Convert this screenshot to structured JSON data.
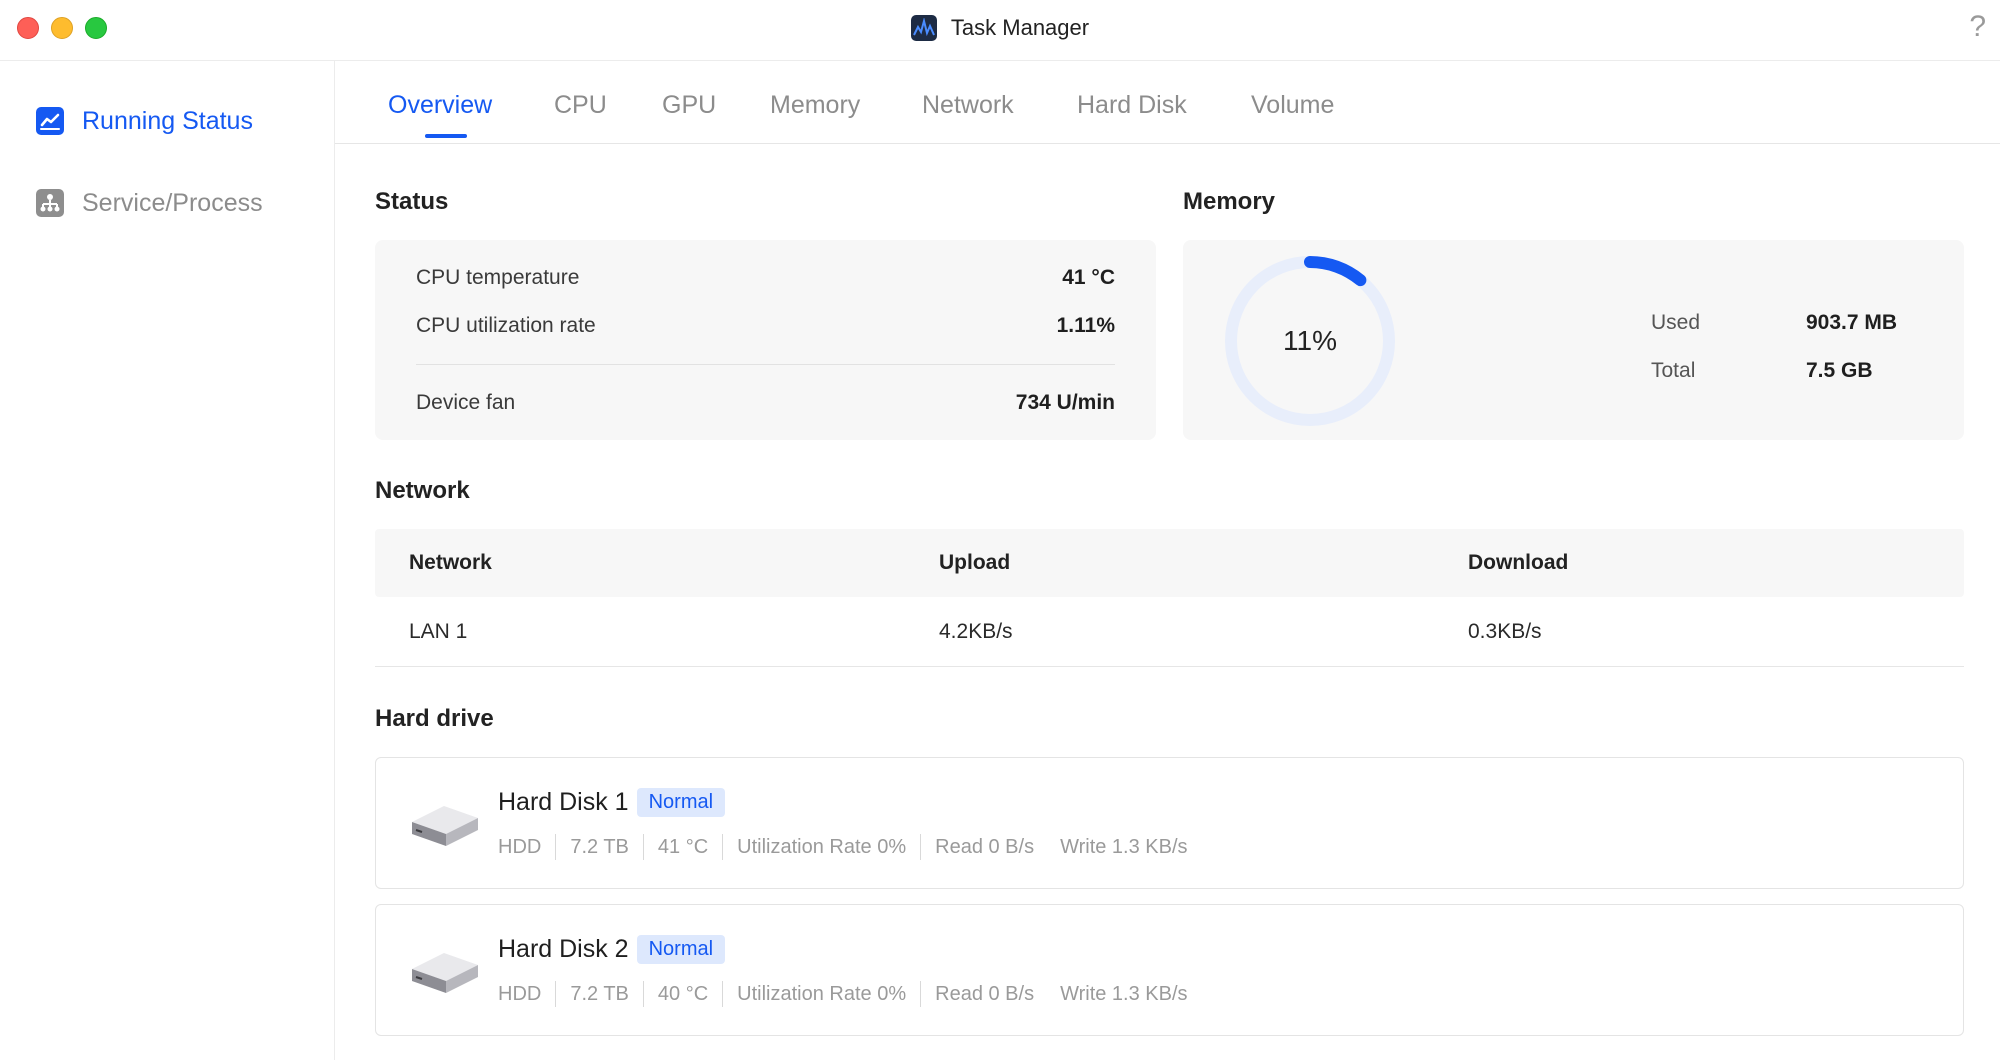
{
  "window": {
    "title": "Task Manager",
    "help": "?"
  },
  "sidebar": {
    "items": [
      {
        "label": "Running Status",
        "icon": "chart-line-icon",
        "active": true
      },
      {
        "label": "Service/Process",
        "icon": "hierarchy-icon",
        "active": false
      }
    ]
  },
  "tabs": [
    "Overview",
    "CPU",
    "GPU",
    "Memory",
    "Network",
    "Hard Disk",
    "Volume"
  ],
  "active_tab": "Overview",
  "status": {
    "title": "Status",
    "rows": [
      {
        "label": "CPU temperature",
        "value": "41 °C"
      },
      {
        "label": "CPU utilization rate",
        "value": "1.11%"
      },
      {
        "label": "Device fan",
        "value": "734 U/min"
      }
    ]
  },
  "memory": {
    "title": "Memory",
    "percent_label": "11%",
    "percent": 11,
    "used_label": "Used",
    "used_value": "903.7 MB",
    "total_label": "Total",
    "total_value": "7.5 GB"
  },
  "network": {
    "title": "Network",
    "columns": [
      "Network",
      "Upload",
      "Download"
    ],
    "rows": [
      {
        "name": "LAN 1",
        "upload": "4.2KB/s",
        "download": "0.3KB/s"
      }
    ]
  },
  "hard_drive": {
    "title": "Hard drive",
    "disks": [
      {
        "name": "Hard Disk 1",
        "status": "Normal",
        "type": "HDD",
        "size": "7.2 TB",
        "temp": "41 °C",
        "util": "Utilization Rate 0%",
        "read": "Read 0 B/s",
        "write": "Write 1.3 KB/s"
      },
      {
        "name": "Hard Disk 2",
        "status": "Normal",
        "type": "HDD",
        "size": "7.2 TB",
        "temp": "40 °C",
        "util": "Utilization Rate 0%",
        "read": "Read 0 B/s",
        "write": "Write 1.3 KB/s"
      }
    ]
  },
  "colors": {
    "accent": "#1559f2",
    "badge_bg": "#dde8fd",
    "card_bg": "#f7f7f7"
  }
}
